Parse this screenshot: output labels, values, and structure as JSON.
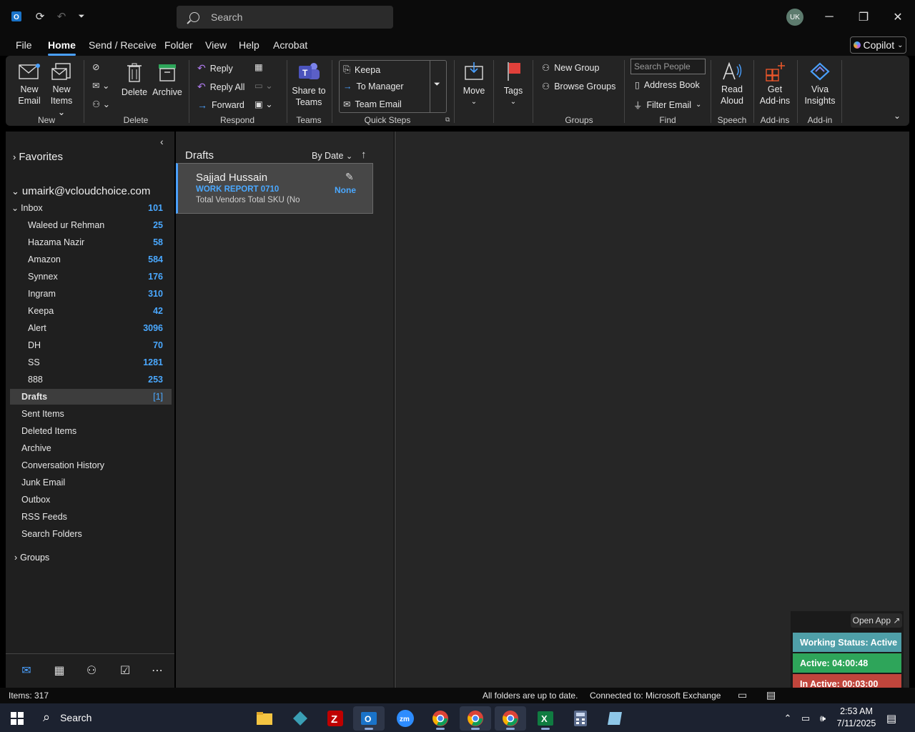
{
  "titlebar": {
    "search_placeholder": "Search",
    "avatar_initials": "UK"
  },
  "menu": {
    "file": "File",
    "home": "Home",
    "send_receive": "Send / Receive",
    "folder": "Folder",
    "view": "View",
    "help": "Help",
    "acrobat": "Acrobat",
    "copilot": "Copilot"
  },
  "ribbon": {
    "new_email": [
      "New",
      "Email"
    ],
    "new_items": [
      "New",
      "Items"
    ],
    "delete": "Delete",
    "archive": "Archive",
    "reply": "Reply",
    "reply_all": "Reply All",
    "forward": "Forward",
    "share_to_teams": [
      "Share to",
      "Teams"
    ],
    "quick_steps": [
      "Keepa",
      "To Manager",
      "Team Email"
    ],
    "move": "Move",
    "tags": "Tags",
    "new_group": "New Group",
    "browse_groups": "Browse Groups",
    "search_people_placeholder": "Search People",
    "address_book": "Address Book",
    "filter_email": "Filter Email",
    "read_aloud": [
      "Read",
      "Aloud"
    ],
    "get_addins": [
      "Get",
      "Add-ins"
    ],
    "viva_insights": [
      "Viva",
      "Insights"
    ],
    "groups": {
      "new": "New",
      "delete": "Delete",
      "respond": "Respond",
      "teams": "Teams",
      "quick_steps": "Quick Steps",
      "groups": "Groups",
      "find": "Find",
      "speech": "Speech",
      "addins": "Add-ins",
      "addin": "Add-in"
    }
  },
  "folders": {
    "favorites": "Favorites",
    "account": "umairk@vcloudchoice.com",
    "inbox": {
      "label": "Inbox",
      "count": "101"
    },
    "subfolders": [
      {
        "label": "Waleed ur Rehman",
        "count": "25"
      },
      {
        "label": "Hazama Nazir",
        "count": "58"
      },
      {
        "label": "Amazon",
        "count": "584"
      },
      {
        "label": "Synnex",
        "count": "176"
      },
      {
        "label": "Ingram",
        "count": "310"
      },
      {
        "label": "Keepa",
        "count": "42"
      },
      {
        "label": "Alert",
        "count": "3096"
      },
      {
        "label": "DH",
        "count": "70"
      },
      {
        "label": "SS",
        "count": "1281"
      },
      {
        "label": "888",
        "count": "253"
      }
    ],
    "drafts": {
      "label": "Drafts",
      "count": "[1]"
    },
    "others": [
      "Sent Items",
      "Deleted Items",
      "Archive",
      "Conversation History",
      "Junk Email",
      "Outbox",
      "RSS Feeds",
      "Search Folders"
    ],
    "groups": "Groups"
  },
  "message_list": {
    "title": "Drafts",
    "sort": "By Date",
    "messages": [
      {
        "from": "Sajjad Hussain",
        "subject": "WORK REPORT 0710",
        "preview": "Total Vendors  Total SKU (No",
        "category": "None"
      }
    ]
  },
  "widget": {
    "open_app": "Open App ↗",
    "working_status": "Working Status: Active",
    "active": "Active: 04:00:48",
    "inactive": "In Active: 00:03:00",
    "colors": {
      "status": "#4f9fa8",
      "active": "#2ea55a",
      "inactive": "#c0453c"
    }
  },
  "statusbar": {
    "items": "Items: 317",
    "sync": "All folders are up to date.",
    "connection": "Connected to: Microsoft Exchange"
  },
  "taskbar": {
    "search": "Search",
    "time": "2:53 AM",
    "date": "7/11/2025"
  }
}
